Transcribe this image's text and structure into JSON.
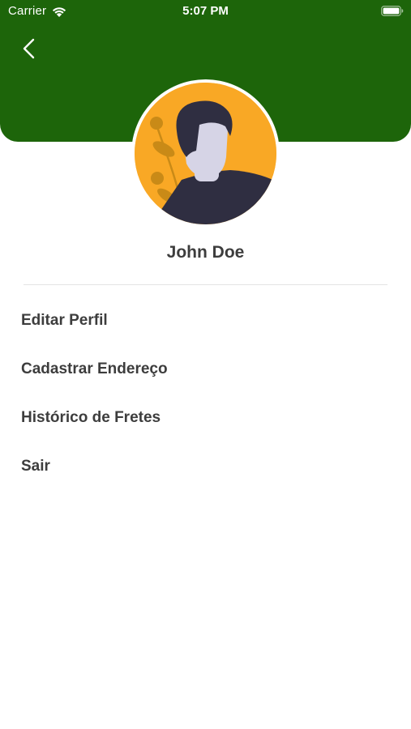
{
  "status_bar": {
    "carrier": "Carrier",
    "time": "5:07 PM"
  },
  "header": {
    "back_icon": "chevron-left-icon",
    "color": "#1d650a"
  },
  "profile": {
    "avatar_colors": {
      "background": "#f9a825",
      "skin": "#d6d4e6",
      "hair": "#2f2e41",
      "shirt": "#2f2e41",
      "leaves": "#c98a17"
    },
    "name": "John Doe"
  },
  "menu": {
    "items": [
      {
        "label": "Editar Perfil"
      },
      {
        "label": "Cadastrar Endereço"
      },
      {
        "label": "Histórico de Fretes"
      },
      {
        "label": "Sair"
      }
    ]
  },
  "colors": {
    "text": "#3d3d3d",
    "divider": "#e4e4e4"
  }
}
